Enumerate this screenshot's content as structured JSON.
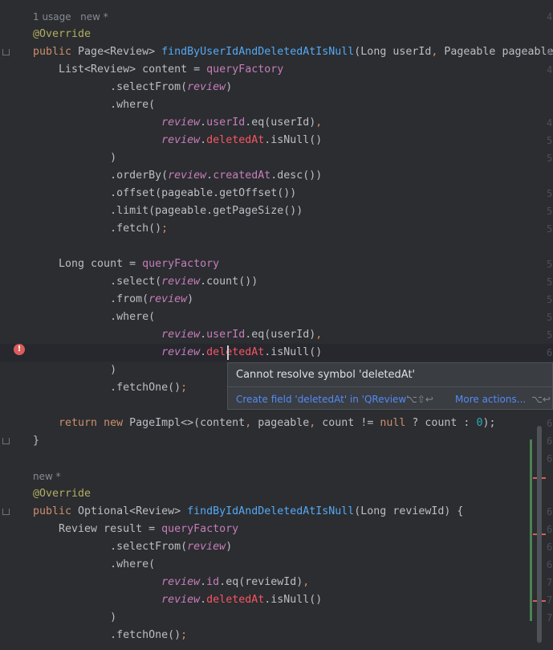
{
  "inlay_hints": {
    "usage_hint": "1 usage   new *",
    "new_hint": "new *"
  },
  "code_lines": [
    {
      "kind": "meta",
      "text": "1 usage   new *"
    },
    {
      "tokens": [
        [
          "@Override",
          "ann"
        ]
      ]
    },
    {
      "tokens": [
        [
          "public ",
          "kw"
        ],
        [
          "Page<Review> ",
          "txt"
        ],
        [
          "findByUserIdAndDeletedAtIsNull",
          "fn"
        ],
        [
          "(Long userId",
          "txt"
        ],
        [
          ", ",
          "kw"
        ],
        [
          "Pageable pageable) {",
          "txt"
        ]
      ]
    },
    {
      "tokens": [
        [
          "    List<Review> content = ",
          "txt"
        ],
        [
          "queryFactory",
          "field"
        ]
      ]
    },
    {
      "tokens": [
        [
          "            .selectFrom(",
          "txt"
        ],
        [
          "review",
          "static"
        ],
        [
          ")",
          "txt"
        ]
      ]
    },
    {
      "tokens": [
        [
          "            .where(",
          "txt"
        ]
      ]
    },
    {
      "tokens": [
        [
          "                    ",
          "txt"
        ],
        [
          "review",
          "static"
        ],
        [
          ".",
          "txt"
        ],
        [
          "userId",
          "field"
        ],
        [
          ".eq(userId)",
          "txt"
        ],
        [
          ",",
          "kw"
        ]
      ]
    },
    {
      "tokens": [
        [
          "                    ",
          "txt"
        ],
        [
          "review",
          "static"
        ],
        [
          ".",
          "txt"
        ],
        [
          "deletedAt",
          "err"
        ],
        [
          ".isNull()",
          "txt"
        ]
      ]
    },
    {
      "tokens": [
        [
          "            )",
          "txt"
        ]
      ]
    },
    {
      "tokens": [
        [
          "            .orderBy(",
          "txt"
        ],
        [
          "review",
          "static"
        ],
        [
          ".",
          "txt"
        ],
        [
          "createdAt",
          "field"
        ],
        [
          ".desc())",
          "txt"
        ]
      ]
    },
    {
      "tokens": [
        [
          "            .offset(pageable.getOffset())",
          "txt"
        ]
      ]
    },
    {
      "tokens": [
        [
          "            .limit(pageable.getPageSize())",
          "txt"
        ]
      ]
    },
    {
      "tokens": [
        [
          "            .fetch()",
          "txt"
        ],
        [
          ";",
          "kw"
        ]
      ]
    },
    {
      "tokens": []
    },
    {
      "tokens": [
        [
          "    Long count = ",
          "txt"
        ],
        [
          "queryFactory",
          "field"
        ]
      ]
    },
    {
      "tokens": [
        [
          "            .select(",
          "txt"
        ],
        [
          "review",
          "static"
        ],
        [
          ".count())",
          "txt"
        ]
      ]
    },
    {
      "tokens": [
        [
          "            .from(",
          "txt"
        ],
        [
          "review",
          "static"
        ],
        [
          ")",
          "txt"
        ]
      ]
    },
    {
      "tokens": [
        [
          "            .where(",
          "txt"
        ]
      ]
    },
    {
      "tokens": [
        [
          "                    ",
          "txt"
        ],
        [
          "review",
          "static"
        ],
        [
          ".",
          "txt"
        ],
        [
          "userId",
          "field"
        ],
        [
          ".eq(userId)",
          "txt"
        ],
        [
          ",",
          "kw"
        ]
      ]
    },
    {
      "current": true,
      "tokens": [
        [
          "                    ",
          "txt"
        ],
        [
          "review",
          "static"
        ],
        [
          ".",
          "txt"
        ],
        [
          "deletedAt",
          "err"
        ],
        [
          ".isNull()",
          "txt"
        ]
      ]
    },
    {
      "tokens": [
        [
          "            )",
          "txt"
        ]
      ]
    },
    {
      "tokens": [
        [
          "            .fetchOne()",
          "txt"
        ],
        [
          ";",
          "kw"
        ]
      ]
    },
    {
      "tokens": []
    },
    {
      "tokens": [
        [
          "    ",
          "txt"
        ],
        [
          "return new ",
          "kw"
        ],
        [
          "PageImpl<>(content",
          "txt"
        ],
        [
          ", ",
          "kw"
        ],
        [
          "pageable",
          "txt"
        ],
        [
          ", ",
          "kw"
        ],
        [
          "count != ",
          "txt"
        ],
        [
          "null ",
          "kw"
        ],
        [
          "? count : ",
          "txt"
        ],
        [
          "0",
          "num"
        ],
        [
          ");",
          "txt"
        ]
      ]
    },
    {
      "tokens": [
        [
          "}",
          "txt"
        ]
      ]
    },
    {
      "tokens": []
    },
    {
      "kind": "meta",
      "text": "new *"
    },
    {
      "tokens": [
        [
          "@Override",
          "ann"
        ]
      ]
    },
    {
      "tokens": [
        [
          "public ",
          "kw"
        ],
        [
          "Optional<Review> ",
          "txt"
        ],
        [
          "findByIdAndDeletedAtIsNull",
          "fn"
        ],
        [
          "(Long reviewId) {",
          "txt"
        ]
      ]
    },
    {
      "tokens": [
        [
          "    Review result = ",
          "txt"
        ],
        [
          "queryFactory",
          "field"
        ]
      ]
    },
    {
      "tokens": [
        [
          "            .selectFrom(",
          "txt"
        ],
        [
          "review",
          "static"
        ],
        [
          ")",
          "txt"
        ]
      ]
    },
    {
      "tokens": [
        [
          "            .where(",
          "txt"
        ]
      ]
    },
    {
      "tokens": [
        [
          "                    ",
          "txt"
        ],
        [
          "review",
          "static"
        ],
        [
          ".",
          "txt"
        ],
        [
          "id",
          "field"
        ],
        [
          ".eq(reviewId)",
          "txt"
        ],
        [
          ",",
          "kw"
        ]
      ]
    },
    {
      "tokens": [
        [
          "                    ",
          "txt"
        ],
        [
          "review",
          "static"
        ],
        [
          ".",
          "txt"
        ],
        [
          "deletedAt",
          "err"
        ],
        [
          ".isNull()",
          "txt"
        ]
      ]
    },
    {
      "tokens": [
        [
          "            )",
          "txt"
        ]
      ]
    },
    {
      "tokens": [
        [
          "            .fetchOne()",
          "txt"
        ],
        [
          ";",
          "kw"
        ]
      ]
    }
  ],
  "right_gutter_digits": [
    "4",
    "",
    "4",
    "4",
    "",
    "",
    "4",
    "5",
    "5",
    "",
    "5",
    "5",
    "5",
    "",
    "5",
    "5",
    "5",
    "5",
    "5",
    "6",
    "6",
    "",
    "",
    "6",
    "6",
    "6",
    "",
    "",
    "6",
    "6",
    "6",
    "6",
    "7",
    "7",
    "7",
    ""
  ],
  "popup": {
    "message": "Cannot resolve symbol 'deletedAt'",
    "primary_action": "Create field 'deletedAt' in 'QReview'",
    "primary_shortcut": "⌥⇧↩",
    "secondary_action": "More actions...",
    "secondary_shortcut": "⌥↩"
  },
  "colors": {
    "background": "#2b2d30",
    "keyword": "#cf8e6d",
    "annotation": "#b3ae60",
    "method": "#56a8f5",
    "field": "#c77dbb",
    "error": "#f75464",
    "number": "#2aacb8",
    "link": "#548af7"
  }
}
